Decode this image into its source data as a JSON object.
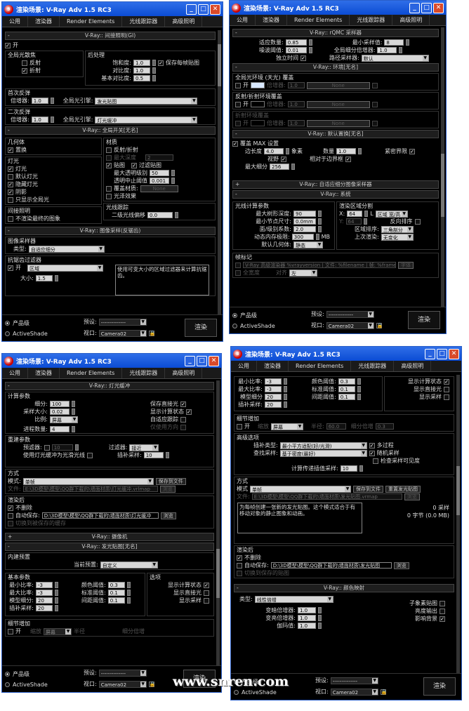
{
  "common": {
    "title": "渲染场景: V-Ray Adv 1.5 RC3",
    "tabs": [
      "公用",
      "渲染器",
      "Render Elements",
      "光线跟踪器",
      "高级照明"
    ],
    "bottom": {
      "production": "产品级",
      "activeshade": "ActiveShade",
      "preset_label": "预设:",
      "preset_value": "--------------",
      "view_label": "视口:",
      "view_value": "Camera02",
      "render": "渲染"
    }
  },
  "tl": {
    "gi_header": "V-Ray:: 间接照明(GI)",
    "on": "开",
    "gi_caustics": "全局光散焦",
    "reflective": "反射",
    "refractive": "折射",
    "post": "后处理",
    "saturation": "饱和度:",
    "saturation_v": "1.0",
    "contrast": "对比度:",
    "contrast_v": "1.0",
    "contrast_base": "基本对比度:",
    "contrast_base_v": "0.5",
    "save_maps": "保存每帧贴图",
    "primary": "首次反弹",
    "mult": "倍增器:",
    "p_mult_v": "1.0",
    "gi_engine": "全局光引擎:",
    "p_engine_v": "发光贴图",
    "secondary": "二次反弹",
    "s_mult_v": "1.0",
    "s_engine_v": "灯光缓冲",
    "gs_header": "V-Ray:: 全局开关[无名]",
    "geometry": "几何体",
    "displacement": "置换",
    "lights": "灯光",
    "lights_cb": "灯光",
    "default_lights": "默认灯光",
    "hidden_lights": "隐藏灯光",
    "shadows": "阴影",
    "only_gi": "只显示全局光",
    "materials": "材质",
    "refl_refr": "反射/折射",
    "max_depth": "最大深度",
    "max_depth_v": "2",
    "maps": "贴图",
    "filter_maps": "过滤贴图",
    "max_transp": "最大透明级别",
    "max_transp_v": "50",
    "transp_cutoff": "透明中止阈值",
    "transp_cutoff_v": "0.001",
    "override_mtl": "覆盖材质:",
    "override_v": "None",
    "glossy": "光泽效果",
    "indirect": "间接照明",
    "no_render_final": "不渲染最终的图象",
    "raytrace": "光线跟踪",
    "sec_bias": "二级光线偏移",
    "sec_bias_v": "0.0",
    "is_header": "V-Ray:: 图像采样(反锯齿)",
    "img_sampler": "图像采样器",
    "type": "类型:",
    "type_v": "自适应细分",
    "aa_filter": "抗锯齿过滤器",
    "aa_on": "开",
    "aa_v": "区域",
    "size": "大小:",
    "size_v": "1.5",
    "aa_desc": "使用可变大小的区域过滤器来计算抗锯齿。"
  },
  "tr": {
    "rqmc_header": "V-Ray:: rQMC 采样器",
    "adapt_amount": "适应数量:",
    "adapt_amount_v": "0.85",
    "min_samples": "最小采样值:",
    "min_samples_v": "8",
    "noise": "噪波阈值:",
    "noise_v": "0.01",
    "global_subdivs": "全局细分倍增器:",
    "global_subdivs_v": "1.0",
    "time_indep": "独立时间",
    "path_sampler": "路径采样器:",
    "path_sampler_v": "默认",
    "env_header": "V-Ray:: 环境[无名]",
    "gi_env": "全局光环境 (天光) 覆盖",
    "on": "开",
    "multiplier": "倍增器:",
    "gi_env_mult": "1.0",
    "none": "None",
    "refl_env": "反射/折射环境覆盖",
    "refl_env_mult": "1.0",
    "refr_env": "折射环境覆盖",
    "refr_env_mult": "1.0",
    "dd_header": "V-Ray:: 默认置换[无名]",
    "override_max": "覆盖 MAX 设置",
    "edge_len": "边长度",
    "edge_len_v": "4.0",
    "pixels": "象素",
    "amount": "数量",
    "amount_v": "1.0",
    "tight_bounds": "紧密界限",
    "view_dep": "视野",
    "relative_bbox": "相对于边界框",
    "max_subdivs": "最大细分",
    "max_subdivs_v": "256",
    "adaptive_header": "V-Ray:: 自适应细分图像采样器",
    "sys_header": "V-Ray:: 系统",
    "raycast": "光线计算参数",
    "max_tree": "最大树形深度:",
    "max_tree_v": "90",
    "min_leaf": "最小节点尺寸:",
    "min_leaf_v": "0.0mm",
    "face_level": "面/级别系数:",
    "face_level_v": "2.0",
    "mem_limit": "动态内存极限:",
    "mem_limit_v": "300",
    "mb": "MB",
    "default_geom": "默认几何体:",
    "default_geom_v": "静态",
    "bucket": "渲染区域分割",
    "bx": "X:",
    "bx_v": "64",
    "bl": "L",
    "by": "Y:",
    "by_v": "64",
    "region_wh": "区域 宽/高",
    "reverse": "反向排序",
    "region_order": "区域排序:",
    "region_order_v": "三角剖分",
    "prev_render": "上次渲染:",
    "prev_render_v": "无变化",
    "stamp": "帧标记",
    "stamp_text": "V-Ray 高级渲染器 %vrayversion | 文件: %filename | 帧: %frame | 基元: %primitives | 渲染时间: %rendertime",
    "font": "字体",
    "full_width": "全宽度",
    "justify": "对齐",
    "justify_v": "左"
  },
  "bl": {
    "lc_header": "V-Ray:: 灯光缓冲",
    "calc_params": "计算参数",
    "subdivs": "细分:",
    "subdivs_v": "100",
    "sample_size": "采样大小:",
    "sample_size_v": "0.02",
    "scale": "比例:",
    "scale_v": "屏幕",
    "passes": "进程数量:",
    "passes_v": "4",
    "store_direct": "保存直接光",
    "show_phase": "显示计算状态",
    "adaptive_tracing": "自适应跟踪",
    "use_dirs": "仅使用方向",
    "recon": "重建参数",
    "prefilter": "预滤器:",
    "prefilter_v": "10",
    "use_lc_glossy": "使用灯光缓冲为光滑光线",
    "filter": "过滤器:",
    "filter_v": "接近",
    "interp_samples": "插补采样:",
    "interp_samples_v": "10",
    "mode_grp": "方式",
    "mode": "模式:",
    "mode_v": "单帧",
    "save_file": "保存到文件",
    "file": "文件:",
    "file_v": "E:\\3D模型\\模型\\QQ群下载的\\墙面材质\\灯光缓冲.vrlmap",
    "browse": "浏览",
    "after": "渲染后",
    "dont_delete": "不删除",
    "auto_save": "自动保存:",
    "auto_save_v": "D:\\3D模型\\模型\\QQ群下载的\\墙面材质\\灯光缓冲",
    "browse2": "浏览",
    "switch_saved": "切换到被保存的缓存",
    "cam_header": "V-Ray:: 摄像机",
    "im_header": "V-Ray:: 发光贴图[无名]",
    "builtin": "内建预置",
    "cur_preset": "当前预置:",
    "cur_preset_v": "自定义",
    "basic": "基本参数",
    "min_rate": "最小比率:",
    "min_rate_v": "-3",
    "max_rate": "最大比率:",
    "max_rate_v": "-3",
    "hsph": "模型细分:",
    "hsph_v": "20",
    "interp": "插补采样:",
    "interp_v": "20",
    "clr_thresh": "颜色阈值:",
    "clr_thresh_v": "0.3",
    "nrm_thresh": "标准阈值:",
    "nrm_thresh_v": "0.1",
    "dist_thresh": "间距阈值:",
    "dist_thresh_v": "0.1",
    "options": "选项",
    "show_calc": "显示计算状态",
    "show_direct": "显示直接光",
    "show_samples": "显示采样",
    "detail": "细节增加",
    "on": "开",
    "scale2": "缩放",
    "radius": "半径",
    "subdivs_mult": "细分倍增"
  },
  "br": {
    "min_rate": "最小比率:",
    "min_rate_v": "-3",
    "max_rate": "最大比率:",
    "max_rate_v": "-3",
    "hsph": "模型细分",
    "hsph_v": "20",
    "interp": "插补采样:",
    "interp_v": "20",
    "clr_thresh": "颜色阈值:",
    "clr_thresh_v": "0.3",
    "nrm_thresh": "标准阈值:",
    "nrm_thresh_v": "0.1",
    "dist_thresh": "间距阈值:",
    "dist_thresh_v": "0.1",
    "show_calc": "显示计算状态",
    "show_direct": "显示直接光",
    "show_samples": "显示采样",
    "detail": "细节增加",
    "on": "开",
    "scale": "缩放",
    "scale_v": "屏幕",
    "radius": "半径:",
    "radius_v": "60.0",
    "subdivs_mult": "细分倍增",
    "subdivs_mult_v": "0.3",
    "advanced": "高级选项",
    "interp_type": "插补类型:",
    "interp_type_v": "最小平方适配(好/光滑)",
    "multipass": "多过程",
    "lookup": "查找采样:",
    "lookup_v": "基于密度(最好)",
    "rand_samples": "随机采样",
    "check_vis": "检查采样可见度",
    "calc_pass": "计算传递插值采样:",
    "calc_pass_v": "10",
    "mode_grp": "方式",
    "mode": "模式",
    "mode_v": "单帧",
    "save_file": "保存到文件",
    "reset": "重置发光贴图",
    "file": "文件:",
    "file_v": "E:\\3D模型\\模型\\QQ群下载的\\墙面材质\\发光贴图.vrmap",
    "browse": "浏览",
    "mode_desc": "为每帧创建一张新的发光贴图。这个模式适合于有移动对象的静止图象和动画。",
    "samples": "0 采样",
    "bytes": "0 字节 (0.0 MB)",
    "after": "渲染后",
    "dont_delete": "不删除",
    "auto_save": "自动保存:",
    "auto_save_v": "D:\\3D模型\\模型\\QQ群下载的\\墙面材质\\发光贴图",
    "browse2": "浏览",
    "switch_saved": "切换到保存的贴图",
    "cm_header": "V-Ray:: 颜色映射",
    "type": "类型:",
    "type_v": "线性倍增",
    "dark_mult": "变暗倍增器:",
    "dark_mult_v": "1.0",
    "bright_mult": "变亮倍增器:",
    "bright_mult_v": "1.0",
    "gamma": "伽玛值:",
    "gamma_v": "1.0",
    "sub_pixel": "子象素贴图",
    "clamp": "亮度输出",
    "affect_bg": "影响背景"
  },
  "watermark": "www.snren.com"
}
